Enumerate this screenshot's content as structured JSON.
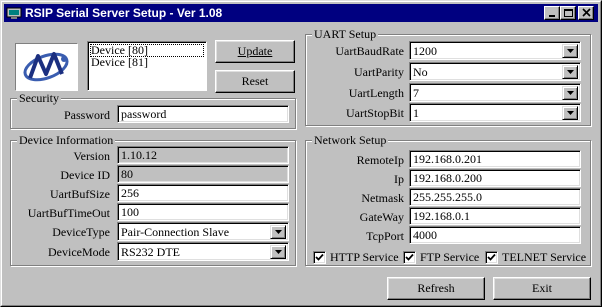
{
  "window": {
    "title": "RSIP Serial Server Setup - Ver 1.08"
  },
  "devices": {
    "items": [
      "Device [80]",
      "Device [81]"
    ]
  },
  "buttons": {
    "update": "Update",
    "reset": "Reset",
    "refresh": "Refresh",
    "exit": "Exit"
  },
  "security": {
    "legend": "Security",
    "password_label": "Password",
    "password_value": "password"
  },
  "device_info": {
    "legend": "Device Information",
    "version_label": "Version",
    "version_value": "1.10.12",
    "device_id_label": "Device ID",
    "device_id_value": "80",
    "buf_size_label": "UartBufSize",
    "buf_size_value": "256",
    "buf_timeout_label": "UartBufTimeOut",
    "buf_timeout_value": "100",
    "device_type_label": "DeviceType",
    "device_type_value": "Pair-Connection Slave",
    "device_mode_label": "DeviceMode",
    "device_mode_value": "RS232 DTE"
  },
  "uart": {
    "legend": "UART Setup",
    "baud_label": "UartBaudRate",
    "baud_value": "1200",
    "parity_label": "UartParity",
    "parity_value": "No",
    "length_label": "UartLength",
    "length_value": "7",
    "stopbit_label": "UartStopBit",
    "stopbit_value": "1"
  },
  "network": {
    "legend": "Network Setup",
    "remoteip_label": "RemoteIp",
    "remoteip_value": "192.168.0.201",
    "ip_label": "Ip",
    "ip_value": "192.168.0.200",
    "netmask_label": "Netmask",
    "netmask_value": "255.255.255.0",
    "gateway_label": "GateWay",
    "gateway_value": "192.168.0.1",
    "tcpport_label": "TcpPort",
    "tcpport_value": "4000",
    "http_label": "HTTP Service",
    "http_checked": true,
    "ftp_label": "FTP Service",
    "ftp_checked": true,
    "telnet_label": "TELNET Service",
    "telnet_checked": true
  },
  "colors": {
    "face": "#c0c0c0",
    "titlebar": "#000080",
    "logo_blue": "#3a5db0"
  },
  "icons": [
    "app-icon",
    "minimize-icon",
    "maximize-icon",
    "close-icon",
    "dropdown-arrow-icon",
    "checkmark-icon",
    "company-logo"
  ]
}
